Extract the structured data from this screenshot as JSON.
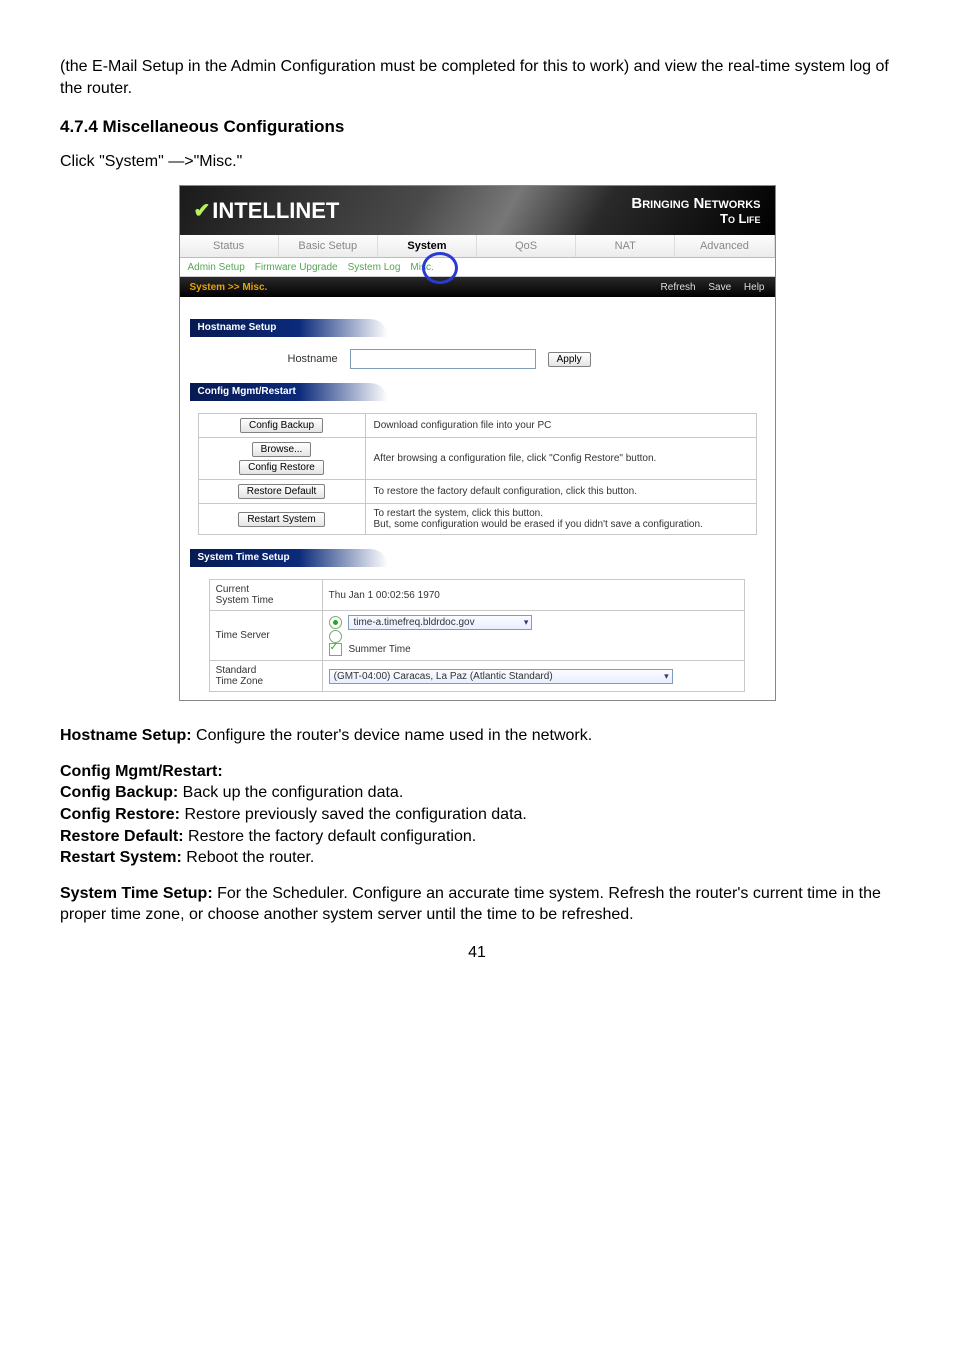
{
  "intro": "(the E-Mail Setup in the Admin Configuration must be completed for this to work) and view the real-time system log of the router.",
  "section_heading": "4.7.4 Miscellaneous Configurations",
  "path_text": "Click \"System\" —>\"Misc.\"",
  "ui": {
    "brand_name": "INTELLINET",
    "tagline_l1": "Bringing Networks",
    "tagline_l2": "To Life",
    "tabs": [
      "Status",
      "Basic Setup",
      "System",
      "QoS",
      "NAT",
      "Advanced"
    ],
    "active_tab_index": 2,
    "subnav": [
      "Admin Setup",
      "Firmware Upgrade",
      "System Log",
      "Misc."
    ],
    "breadcrumb": "System >> Misc.",
    "actions": [
      "Refresh",
      "Save",
      "Help"
    ],
    "hostname": {
      "title": "Hostname Setup",
      "label": "Hostname",
      "apply_btn": "Apply"
    },
    "cfg": {
      "title": "Config Mgmt/Restart",
      "rows": [
        {
          "btn": "Config Backup",
          "desc": "Download configuration file into your PC"
        },
        {
          "btn": "Config Restore",
          "browse": "Browse...",
          "desc": "After browsing a configuration file, click \"Config Restore\" button."
        },
        {
          "btn": "Restore Default",
          "desc": "To restore the factory default configuration, click this button."
        },
        {
          "btn": "Restart System",
          "desc": "To restart the system, click this button.\nBut, some configuration would be erased if you didn't save a configuration."
        }
      ]
    },
    "time": {
      "title": "System Time Setup",
      "current_label": "Current\nSystem Time",
      "current_value": "Thu Jan 1 00:02:56 1970",
      "server_label": "Time Server",
      "server_select": "time-a.timefreq.bldrdoc.gov",
      "summer": "Summer Time",
      "tz_label": "Standard\nTime Zone",
      "tz_value": "(GMT-04:00) Caracas, La Paz (Atlantic Standard)"
    }
  },
  "descs": {
    "hostname": {
      "h": "Hostname Setup:",
      "t": " Configure the router's device name used in the network."
    },
    "cfg_title": "Config Mgmt/Restart:",
    "cfg_backup": {
      "h": "Config Backup:",
      "t": " Back up the configuration data."
    },
    "cfg_restore": {
      "h": "Config Restore:",
      "t": " Restore previously saved the configuration data."
    },
    "cfg_default": {
      "h": "Restore Default:",
      "t": " Restore the factory default configuration."
    },
    "cfg_restart": {
      "h": "Restart System:",
      "t": " Reboot the router."
    },
    "time": {
      "h": "System Time Setup:",
      "t": " For the Scheduler. Configure an accurate time system. Refresh the router's current time in the proper time zone, or choose another system server until the time to be refreshed."
    }
  },
  "page_number": "41"
}
